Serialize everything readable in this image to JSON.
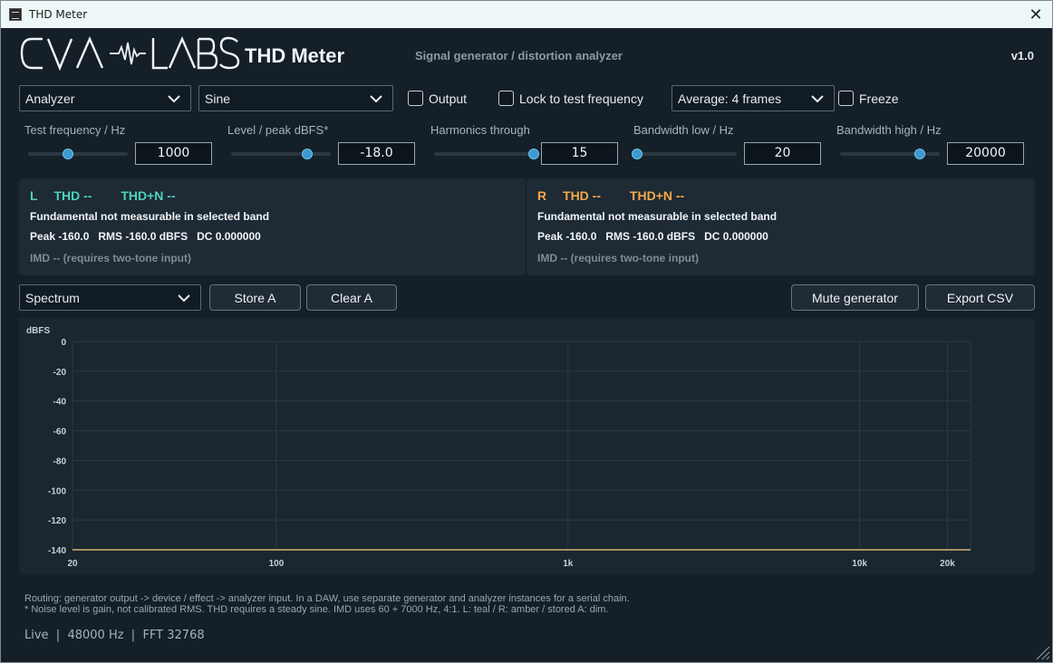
{
  "window": {
    "title": "THD Meter",
    "close_glyph": "✕"
  },
  "header": {
    "logo_text": "CVA LABS",
    "plugin_name": "THD Meter",
    "subtitle": "Signal generator / distortion analyzer",
    "version": "v1.0"
  },
  "controls": {
    "mode": "Analyzer",
    "waveform": "Sine",
    "output_label": "Output",
    "output_checked": false,
    "lock_label": "Lock to test frequency",
    "lock_checked": false,
    "average": "Average: 4 frames",
    "freeze_label": "Freeze",
    "freeze_checked": false
  },
  "params": [
    {
      "label": "Test frequency / Hz",
      "value": "1000",
      "fraction": 0.4
    },
    {
      "label": "Level / peak dBFS*",
      "value": "-18.0",
      "fraction": 0.76
    },
    {
      "label": "Harmonics through",
      "value": "15",
      "fraction": 1.0
    },
    {
      "label": "Bandwidth low / Hz",
      "value": "20",
      "fraction": 0.0
    },
    {
      "label": "Bandwidth high / Hz",
      "value": "20000",
      "fraction": 0.8
    }
  ],
  "channels": {
    "left": {
      "id": "L",
      "thd": "THD --",
      "thdn": "THD+N --",
      "status": "Fundamental not measurable in selected band",
      "levels": "Peak -160.0   RMS -160.0 dBFS   DC 0.000000",
      "imd": "IMD -- (requires two-tone input)",
      "color": "#4fd1bd"
    },
    "right": {
      "id": "R",
      "thd": "THD --",
      "thdn": "THD+N --",
      "status": "Fundamental not measurable in selected band",
      "levels": "Peak -160.0   RMS -160.0 dBFS   DC 0.000000",
      "imd": "IMD -- (requires two-tone input)",
      "color": "#f2a94b"
    }
  },
  "toolbar": {
    "view": "Spectrum",
    "store_a": "Store A",
    "clear_a": "Clear A",
    "mute_generator": "Mute generator",
    "export_csv": "Export CSV"
  },
  "chart_data": {
    "type": "line",
    "ylabel": "dBFS",
    "x_scale": "log",
    "xlim": [
      20,
      24000
    ],
    "ylim": [
      -140,
      0
    ],
    "x_ticks": [
      20,
      100,
      1000,
      10000,
      20000
    ],
    "x_tick_labels": [
      "20",
      "100",
      "1k",
      "10k",
      "20k"
    ],
    "y_ticks": [
      0,
      -20,
      -40,
      -60,
      -80,
      -100,
      -120,
      -140
    ],
    "y_tick_labels": [
      "0",
      "-20",
      "-40",
      "-60",
      "-80",
      "-100",
      "-120",
      "-140"
    ],
    "grid": true,
    "series": [
      {
        "color": "#d8b36a",
        "x": [
          20,
          24000
        ],
        "y": [
          -140,
          -140
        ]
      }
    ]
  },
  "footer": {
    "note1": "Routing: generator output -> device / effect -> analyzer input. In a DAW, use separate generator and analyzer instances for a serial chain.",
    "note2": "* Noise level is gain, not calibrated RMS. THD requires a steady sine. IMD uses 60 + 7000 Hz, 4:1. L: teal / R: amber / stored A: dim.",
    "status": "Live  |  48000 Hz  |  FFT 32768"
  },
  "icons": {
    "chevron": "chevron-down-icon",
    "logo": "cva-labs-logo",
    "resize": "resize-grip-icon"
  }
}
